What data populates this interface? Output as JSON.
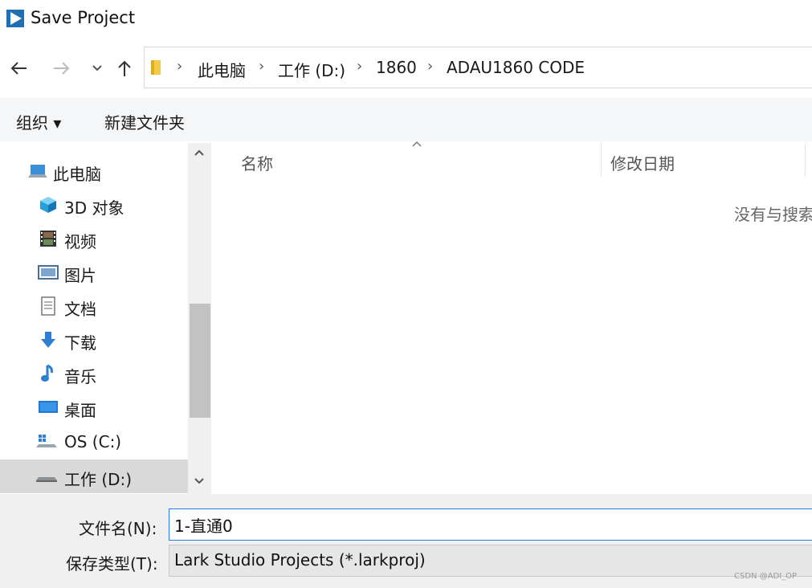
{
  "window": {
    "title": "Save Project",
    "app_icon": "play-triangle-icon",
    "accent_color": "#1f6fb5"
  },
  "nav": {
    "back_icon": "arrow-left-icon",
    "forward_icon": "arrow-right-icon",
    "recent_icon": "chevron-down-icon",
    "up_icon": "arrow-up-icon"
  },
  "address": {
    "folder_icon": "folder-icon",
    "crumbs": [
      "此电脑",
      "工作 (D:)",
      "1860",
      "ADAU1860 CODE"
    ],
    "separator": "›"
  },
  "toolbar": {
    "organize_label": "组织 ▾",
    "new_folder_label": "新建文件夹"
  },
  "sidebar": {
    "items": [
      {
        "label": "此电脑",
        "icon": "computer-icon"
      },
      {
        "label": "3D 对象",
        "icon": "cube-3d-icon"
      },
      {
        "label": "视频",
        "icon": "film-icon"
      },
      {
        "label": "图片",
        "icon": "picture-icon"
      },
      {
        "label": "文档",
        "icon": "document-icon"
      },
      {
        "label": "下载",
        "icon": "download-arrow-icon"
      },
      {
        "label": "音乐",
        "icon": "music-note-icon"
      },
      {
        "label": "桌面",
        "icon": "desktop-icon"
      },
      {
        "label": "OS (C:)",
        "icon": "windows-drive-icon"
      },
      {
        "label": "工作 (D:)",
        "icon": "drive-icon"
      }
    ],
    "selected_index": 9
  },
  "file_list": {
    "columns": [
      "名称",
      "修改日期"
    ],
    "empty_message": "没有与搜索"
  },
  "form": {
    "filename_label": "文件名(N):",
    "filename_value": "1-直通0",
    "filetype_label": "保存类型(T):",
    "filetype_value": "Lark Studio Projects (*.larkproj)"
  },
  "watermark": "CSDN @ADI_OP"
}
